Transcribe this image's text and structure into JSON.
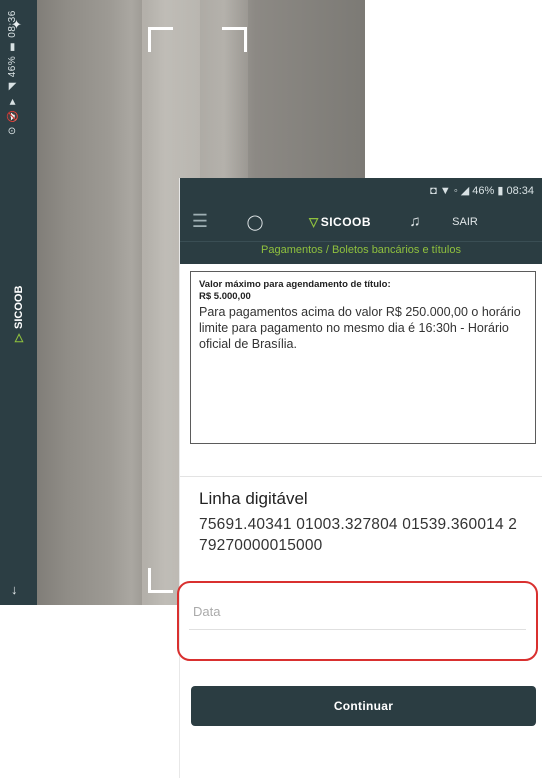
{
  "scanner": {
    "status_text": "⊙ 🔇 ▼ ◢ 46% ▮ 08:36",
    "logo_mark": "▽",
    "logo_text": "SICOOB",
    "flash_icon": "✦",
    "down_icon": "↓"
  },
  "statusbar": {
    "text": "◘ ▼ ◦ ◢ 46% ▮ 08:34"
  },
  "header": {
    "menu_icon": "☰",
    "chat_icon": "◯",
    "logo_mark": "▽",
    "logo_text": "SICOOB",
    "bell_icon": "♫",
    "exit_label": "SAIR"
  },
  "breadcrumb": "Pagamentos / Boletos bancários e títulos",
  "info": {
    "limit_title": "Valor máximo para agendamento de título:",
    "limit_value": "R$ 5.000,00",
    "message": "Para pagamentos acima do valor R$ 250.000,00 o horário limite para pagamento no mesmo dia é 16:30h - Horário oficial de Brasília."
  },
  "linha": {
    "label": "Linha digitável",
    "value": "75691.40341 01003.327804 01539.360014 2 79270000015000"
  },
  "date": {
    "placeholder": "Data"
  },
  "continue_label": "Continuar",
  "colors": {
    "header_bg": "#2b3d42",
    "brand_green": "#8fc13e",
    "highlight_red": "#d9302f"
  }
}
